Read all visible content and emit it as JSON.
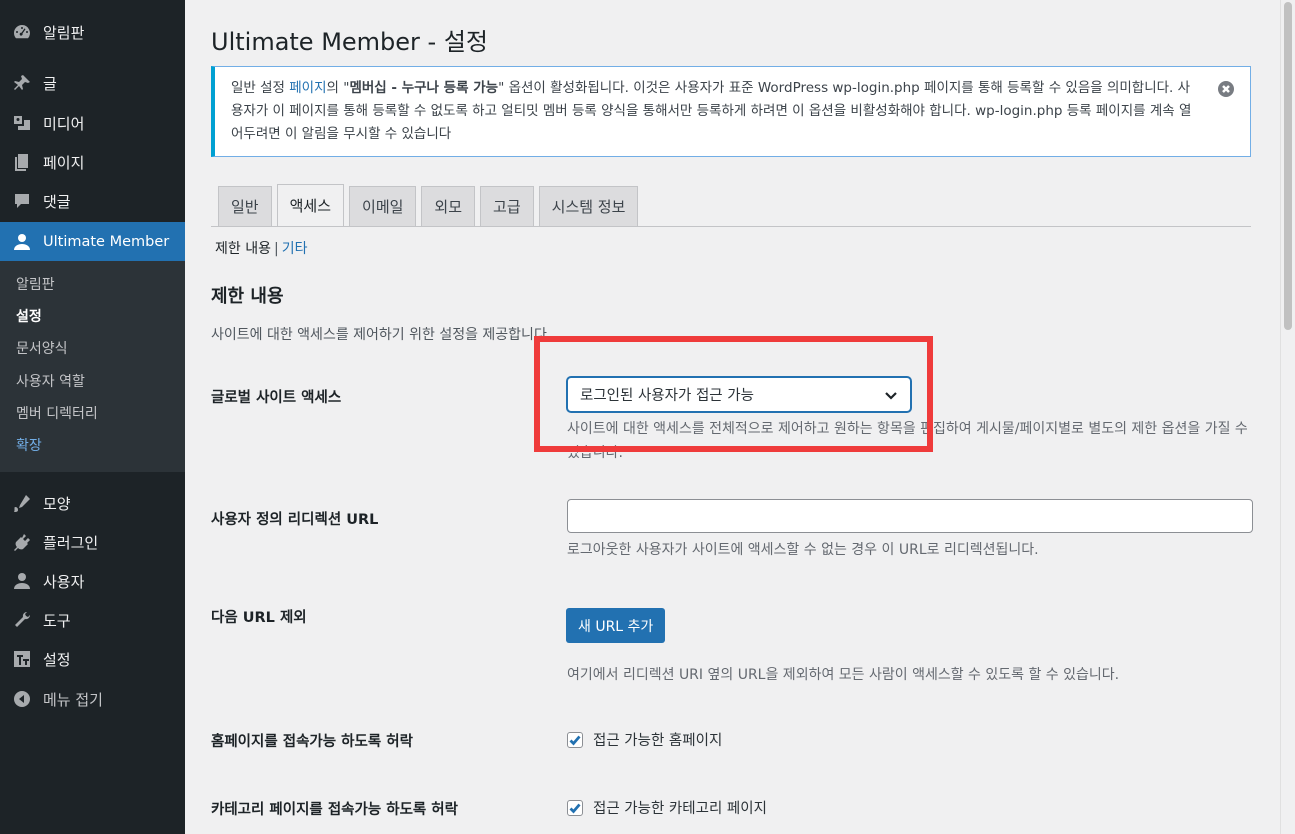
{
  "sidebar": {
    "items": [
      {
        "label": "알림판",
        "icon": "dashboard-icon"
      },
      {
        "label": "글",
        "icon": "pin-icon"
      },
      {
        "label": "미디어",
        "icon": "media-icon"
      },
      {
        "label": "페이지",
        "icon": "page-icon"
      },
      {
        "label": "댓글",
        "icon": "comment-icon"
      },
      {
        "label": "Ultimate Member",
        "icon": "user-icon",
        "active": true
      },
      {
        "label": "모양",
        "icon": "appearance-icon"
      },
      {
        "label": "플러그인",
        "icon": "plugin-icon"
      },
      {
        "label": "사용자",
        "icon": "users-icon"
      },
      {
        "label": "도구",
        "icon": "tools-icon"
      },
      {
        "label": "설정",
        "icon": "settings-icon"
      },
      {
        "label": "메뉴 접기",
        "icon": "collapse-icon"
      }
    ],
    "submenu": [
      "알림판",
      "설정",
      "문서양식",
      "사용자 역할",
      "멤버 디렉터리",
      "확장"
    ]
  },
  "page": {
    "title": "Ultimate Member - 설정"
  },
  "notice": {
    "pre": "일반 설정 ",
    "link": "페이지",
    "mid": "의 \"",
    "bold": "멤버십 - 누구나 등록 가능",
    "post": "\" 옵션이 활성화됩니다. 이것은 사용자가 표준 WordPress wp-login.php 페이지를 통해 등록할 수 있음을 의미합니다. 사용자가 이 페이지를 통해 등록할 수 없도록 하고 얼티밋 멤버 등록 양식을 통해서만 등록하게 하려면 이 옵션을 비활성화해야 합니다. wp-login.php 등록 페이지를 계속 열어두려면 이 알림을 무시할 수 있습니다"
  },
  "tabs": [
    "일반",
    "액세스",
    "이메일",
    "외모",
    "고급",
    "시스템 정보"
  ],
  "subnav": {
    "current": "제한 내용",
    "separator": "|",
    "other": "기타"
  },
  "section": {
    "title": "제한 내용",
    "description": "사이트에 대한 액세스를 제어하기 위한 설정을 제공합니다."
  },
  "fields": {
    "global_access": {
      "label": "글로벌 사이트 액세스",
      "value": "로그인된 사용자가 접근 가능",
      "description": "사이트에 대한 액세스를 전체적으로 제어하고 원하는 항목을 편집하여 게시물/페이지별로 별도의 제한 옵션을 가질 수 있습니다."
    },
    "redirect_url": {
      "label": "사용자 정의 리디렉션 URL",
      "value": "",
      "description": "로그아웃한 사용자가 사이트에 액세스할 수 없는 경우 이 URL로 리디렉션됩니다."
    },
    "exclude_urls": {
      "label": "다음 URL 제외",
      "button": "새 URL 추가",
      "description": "여기에서 리디렉션 URI 옆의 URL을 제외하여 모든 사람이 액세스할 수 있도록 할 수 있습니다."
    },
    "homepage": {
      "label": "홈페이지를 접속가능 하도록 허락",
      "checkbox_label": "접근 가능한 홈페이지",
      "checked": true
    },
    "category": {
      "label": "카테고리 페이지를 접속가능 하도록 허락",
      "checkbox_label": "접근 가능한 카테고리 페이지",
      "checked": true
    }
  },
  "colors": {
    "accent": "#2271b1",
    "highlight_box": "#ef3b3b",
    "sidebar_bg": "#1d2327"
  }
}
